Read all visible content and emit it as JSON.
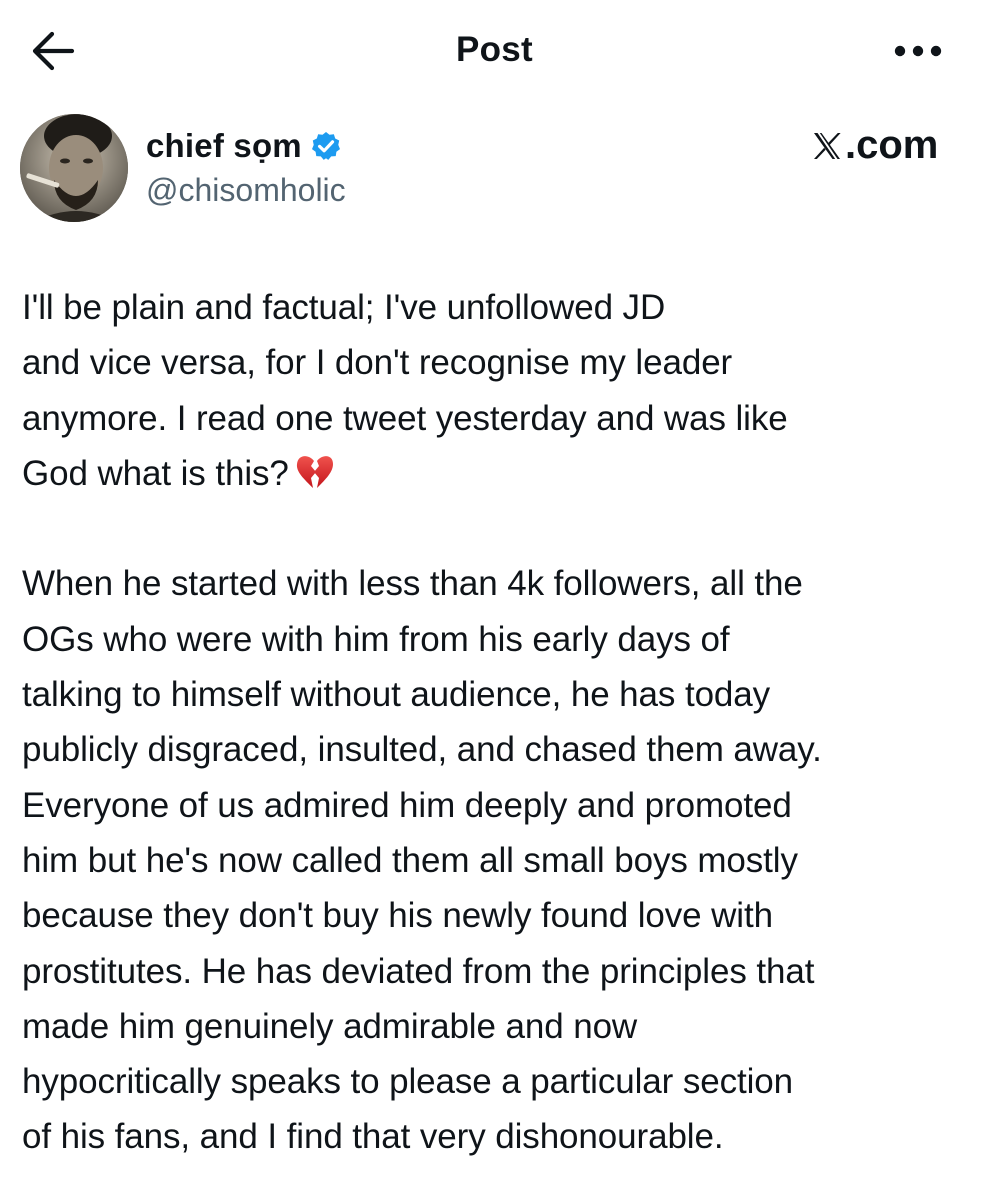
{
  "header": {
    "title": "Post",
    "back_icon": "back-arrow-icon",
    "more_icon": "more-horizontal-icon"
  },
  "author": {
    "name": "chief sọm",
    "handle": "@chisomholic",
    "verified_icon": "verified-badge-icon",
    "verified_color": "#1d9bf0"
  },
  "brand": {
    "label": ".com",
    "icon": "x-logo-icon"
  },
  "post": {
    "paragraph1": [
      "I'll be plain and factual; I've unfollowed JD",
      " and vice versa, for I don't recognise my leader",
      "anymore. I read one tweet yesterday and was like",
      "God what is this?"
    ],
    "emoji": "broken-heart-icon",
    "paragraph2": [
      "When he started with less than 4k followers, all the",
      "OGs who were with him from his early days of",
      "talking to himself without audience, he has today",
      "publicly disgraced, insulted, and chased them away.",
      "Everyone of us admired him deeply and promoted",
      "him but he's now called them all small boys mostly",
      "because they don't buy his newly found love with",
      "prostitutes. He has deviated from the principles that",
      "made him genuinely admirable and now",
      "hypocritically speaks to please a particular section",
      "of his fans, and I find that very dishonourable."
    ]
  },
  "colors": {
    "text": "#0f1419",
    "secondary_text": "#536471",
    "background": "#ffffff"
  }
}
